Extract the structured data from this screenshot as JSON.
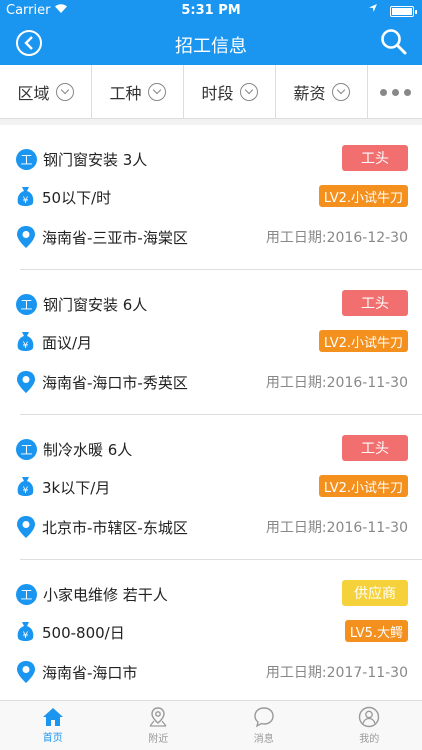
{
  "status": {
    "carrier": "Carrier",
    "time": "5:31 PM",
    "battery_level": 1.0
  },
  "nav": {
    "title": "招工信息"
  },
  "filters": [
    {
      "label": "区域"
    },
    {
      "label": "工种"
    },
    {
      "label": "时段"
    },
    {
      "label": "薪资"
    }
  ],
  "jobs": [
    {
      "title": "钢门窗安装 3人",
      "pay": "50以下/时",
      "location": "海南省-三亚市-海棠区",
      "role_tag": "工头",
      "role_color": "#f26f6f",
      "level": "LV2.小试牛刀",
      "date": "用工日期:2016-12-30"
    },
    {
      "title": "钢门窗安装 6人",
      "pay": "面议/月",
      "location": "海南省-海口市-秀英区",
      "role_tag": "工头",
      "role_color": "#f26f6f",
      "level": "LV2.小试牛刀",
      "date": "用工日期:2016-11-30"
    },
    {
      "title": "制冷水暖 6人",
      "pay": "3k以下/月",
      "location": "北京市-市辖区-东城区",
      "role_tag": "工头",
      "role_color": "#f26f6f",
      "level": "LV2.小试牛刀",
      "date": "用工日期:2016-11-30"
    },
    {
      "title": "小家电维修 若干人",
      "pay": "500-800/日",
      "location": "海南省-海口市",
      "role_tag": "供应商",
      "role_color": "#f5d23c",
      "level": "LV5.大鳄",
      "date": "用工日期:2017-11-30"
    }
  ],
  "icons": {
    "job": "工",
    "yen": "¥"
  },
  "tabs": [
    {
      "label": "首页",
      "icon": "home-icon",
      "active": true
    },
    {
      "label": "附近",
      "icon": "map-pin-icon",
      "active": false
    },
    {
      "label": "消息",
      "icon": "chat-bubble-icon",
      "active": false
    },
    {
      "label": "我的",
      "icon": "user-icon",
      "active": false
    }
  ],
  "colors": {
    "primary": "#1a96f0",
    "level_tag": "#f4901e"
  }
}
